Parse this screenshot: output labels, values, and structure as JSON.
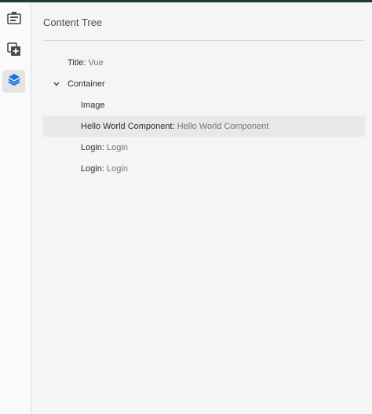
{
  "rail": {
    "buttons": [
      {
        "name": "components-icon"
      },
      {
        "name": "assets-icon"
      },
      {
        "name": "content-tree-icon"
      }
    ],
    "accent": "#1473e6"
  },
  "panel": {
    "title": "Content Tree",
    "tree": [
      {
        "key": "Title",
        "value": "Vue"
      },
      {
        "key": "Container",
        "value": ""
      },
      {
        "key": "Image",
        "value": ""
      },
      {
        "key": "Hello World Component",
        "value": "Hello World Component"
      },
      {
        "key": "Login",
        "value": "Login"
      },
      {
        "key": "Login",
        "value": "Login"
      }
    ]
  }
}
